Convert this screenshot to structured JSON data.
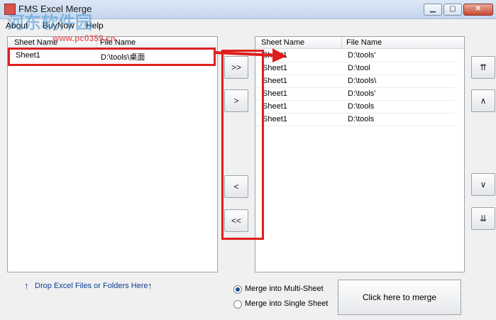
{
  "window": {
    "title": "FMS Excel Merge",
    "minimize": "▁",
    "maximize": "▢",
    "close": "✕"
  },
  "menu": [
    "About",
    "BuyNow",
    "Help"
  ],
  "watermark": {
    "text": "河东软件园",
    "url": "www.pc0359.cn"
  },
  "left_panel": {
    "headers": [
      "Sheet Name",
      "File Name"
    ],
    "rows": [
      {
        "sheet": "Sheet1",
        "file": "D:\\tools\\桌面"
      }
    ]
  },
  "right_panel": {
    "headers": [
      "Sheet Name",
      "File Name"
    ],
    "rows": [
      {
        "sheet": "Sheet1",
        "file": "D:\\tools'"
      },
      {
        "sheet": "Sheet1",
        "file": "D:\\tool"
      },
      {
        "sheet": "Sheet1",
        "file": "D:\\tools\\"
      },
      {
        "sheet": "Sheet1",
        "file": "D:\\tools'"
      },
      {
        "sheet": "Sheet1",
        "file": "D:\\tools"
      },
      {
        "sheet": "Sheet1",
        "file": "D:\\tools"
      }
    ]
  },
  "transfer_buttons": {
    "add_all": ">>",
    "add_one": ">",
    "remove_one": "<",
    "remove_all": "<<"
  },
  "order_buttons": {
    "top": "⇈",
    "up": "∧",
    "down": "∨",
    "bottom": "⇊"
  },
  "drop_hint": "Drop Excel Files or Folders Here",
  "drop_arrow": "↑",
  "merge_options": {
    "multi": "Merge into Multi-Sheet",
    "single": "Merge into Single Sheet",
    "selected": "multi"
  },
  "merge_button": "Click here to merge",
  "colors": {
    "highlight": "#e01e1e",
    "titlebar": "#c4d6ec",
    "link": "#0b3d91"
  }
}
